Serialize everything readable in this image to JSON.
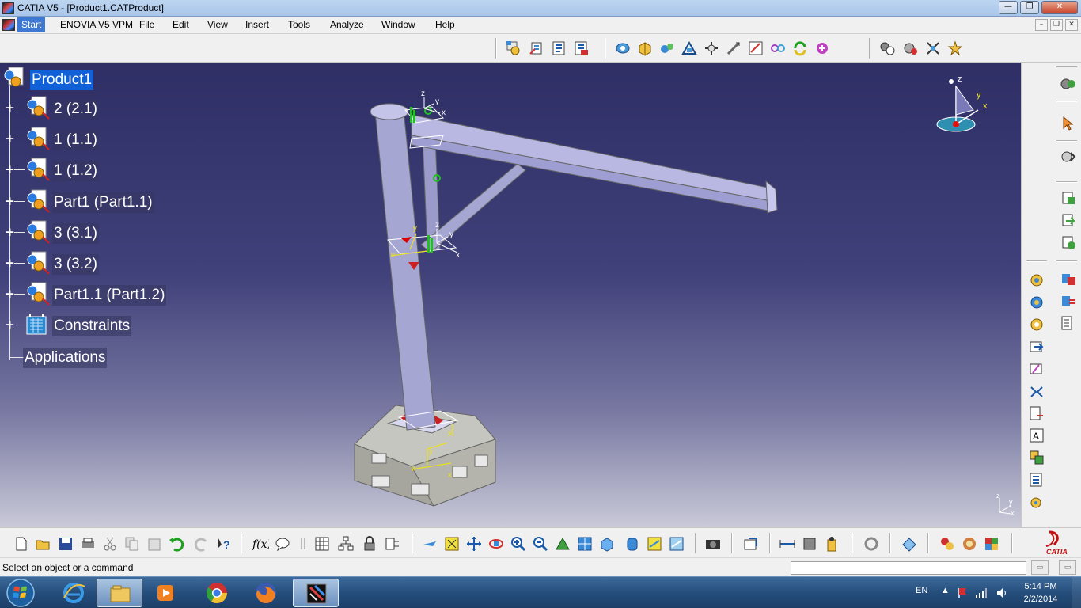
{
  "window": {
    "title": "CATIA V5 - [Product1.CATProduct]"
  },
  "menu": {
    "items": [
      "Start",
      "ENOVIA V5 VPM",
      "File",
      "Edit",
      "View",
      "Insert",
      "Tools",
      "Analyze",
      "Window",
      "Help"
    ]
  },
  "tree": {
    "root": "Product1",
    "nodes": [
      "2 (2.1)",
      "1 (1.1)",
      "1 (1.2)",
      "Part1 (Part1.1)",
      "3 (3.1)",
      "3 (3.2)",
      "Part1.1 (Part1.2)",
      "Constraints",
      "Applications"
    ]
  },
  "compass": {
    "z": "z",
    "y": "y",
    "x": "x"
  },
  "viewport_axes": {
    "z": "z",
    "y": "y",
    "x": "x"
  },
  "statusbar": {
    "text": "Select an object or a command",
    "command_value": ""
  },
  "taskbar": {
    "language": "EN",
    "time": "5:14 PM",
    "date": "2/2/2014"
  },
  "logo": {
    "text": "CATIA"
  },
  "colors": {
    "selection": "#1060d8",
    "viewport_top": "#2f2f66",
    "viewport_bottom": "#c9c9d8",
    "model_part": "#b8b8e6",
    "base_block": "#a8a8a0"
  }
}
